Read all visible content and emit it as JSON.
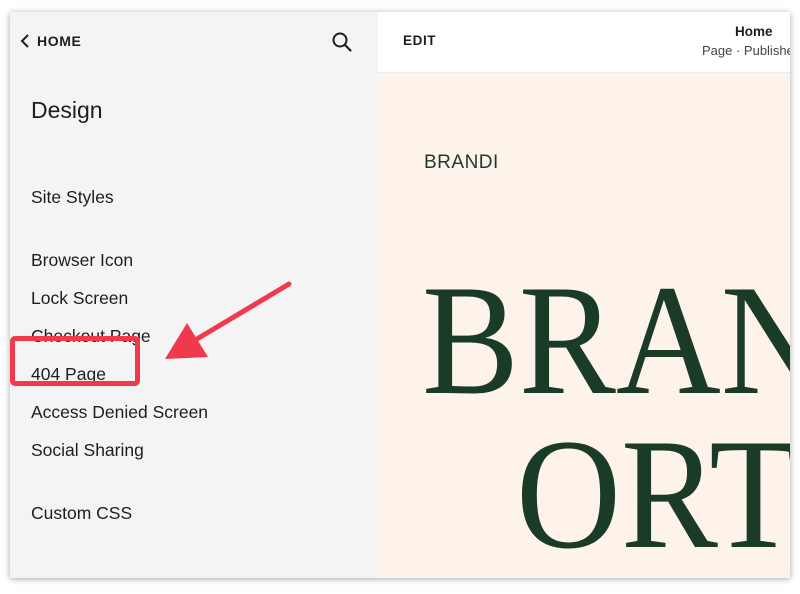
{
  "sidebar": {
    "back_label": "HOME",
    "title": "Design",
    "items": [
      {
        "label": "Site Styles"
      },
      {
        "label": "Browser Icon"
      },
      {
        "label": "Lock Screen"
      },
      {
        "label": "Checkout Page"
      },
      {
        "label": "404 Page"
      },
      {
        "label": "Access Denied Screen"
      },
      {
        "label": "Social Sharing"
      },
      {
        "label": "Custom CSS"
      }
    ]
  },
  "preview": {
    "edit_label": "EDIT",
    "page_name": "Home",
    "page_status": "Page · Published",
    "brand_small": "BRANDI",
    "hero_line1": "BRANDI",
    "hero_line2": "ORTEGA"
  },
  "annotation": {
    "highlighted_item": "404 Page",
    "color": "#ef3a4d"
  },
  "colors": {
    "sidebar_bg": "#f4f4f4",
    "preview_bg": "#fdf3ea",
    "hero_text": "#1a3b26"
  }
}
